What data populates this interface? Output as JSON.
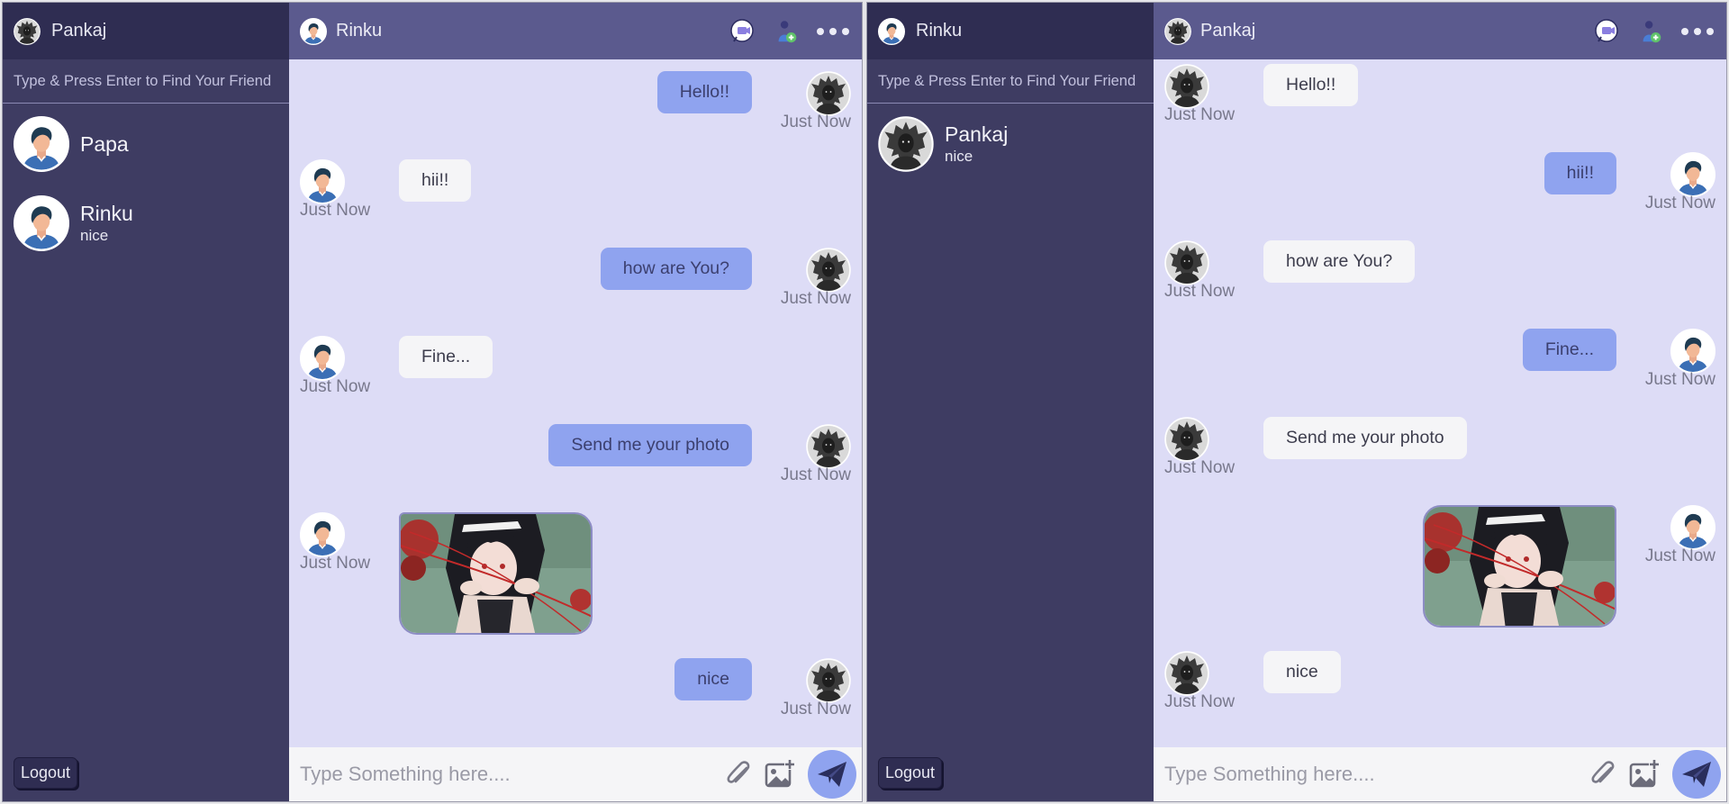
{
  "left": {
    "current_user": "Pankaj",
    "search_placeholder": "Type & Press Enter to Find Your Friend",
    "contacts": [
      {
        "name": "Papa",
        "last": ""
      },
      {
        "name": "Rinku",
        "last": "nice"
      }
    ],
    "logout_label": "Logout",
    "chat": {
      "partner": "Rinku",
      "messages": [
        {
          "text": "Hello!!",
          "time": "Just Now"
        },
        {
          "text": "hii!!",
          "time": "Just Now"
        },
        {
          "text": "how are You?",
          "time": "Just Now"
        },
        {
          "text": "Fine...",
          "time": "Just Now"
        },
        {
          "text": "Send me your photo",
          "time": "Just Now"
        },
        {
          "text": "",
          "time": "Just Now"
        },
        {
          "text": "nice",
          "time": "Just Now"
        }
      ],
      "input_placeholder": "Type Something here...."
    }
  },
  "right": {
    "current_user": "Rinku",
    "search_placeholder": "Type & Press Enter to Find Your Friend",
    "contacts": [
      {
        "name": "Pankaj",
        "last": "nice"
      }
    ],
    "logout_label": "Logout",
    "chat": {
      "partner": "Pankaj",
      "messages": [
        {
          "text": "Hello!!",
          "time": "Just Now"
        },
        {
          "text": "hii!!",
          "time": "Just Now"
        },
        {
          "text": "how are You?",
          "time": "Just Now"
        },
        {
          "text": "Fine...",
          "time": "Just Now"
        },
        {
          "text": "Send me your photo",
          "time": "Just Now"
        },
        {
          "text": "",
          "time": "Just Now"
        },
        {
          "text": "nice",
          "time": "Just Now"
        }
      ],
      "input_placeholder": "Type Something here...."
    }
  },
  "icons": {
    "video_call": "video-call-icon",
    "add_friend": "add-friend-icon",
    "more": "more-options-icon",
    "attach": "paperclip-icon",
    "add_image": "add-image-icon",
    "send": "send-icon"
  },
  "colors": {
    "sidebar": "#3e3c62",
    "sidebar_header": "#2f2d52",
    "chat_header": "#5b5a8e",
    "chat_bg": "#dddcf6",
    "bubble_mine": "#8fa3ef",
    "bubble_theirs": "#f5f5f7"
  }
}
